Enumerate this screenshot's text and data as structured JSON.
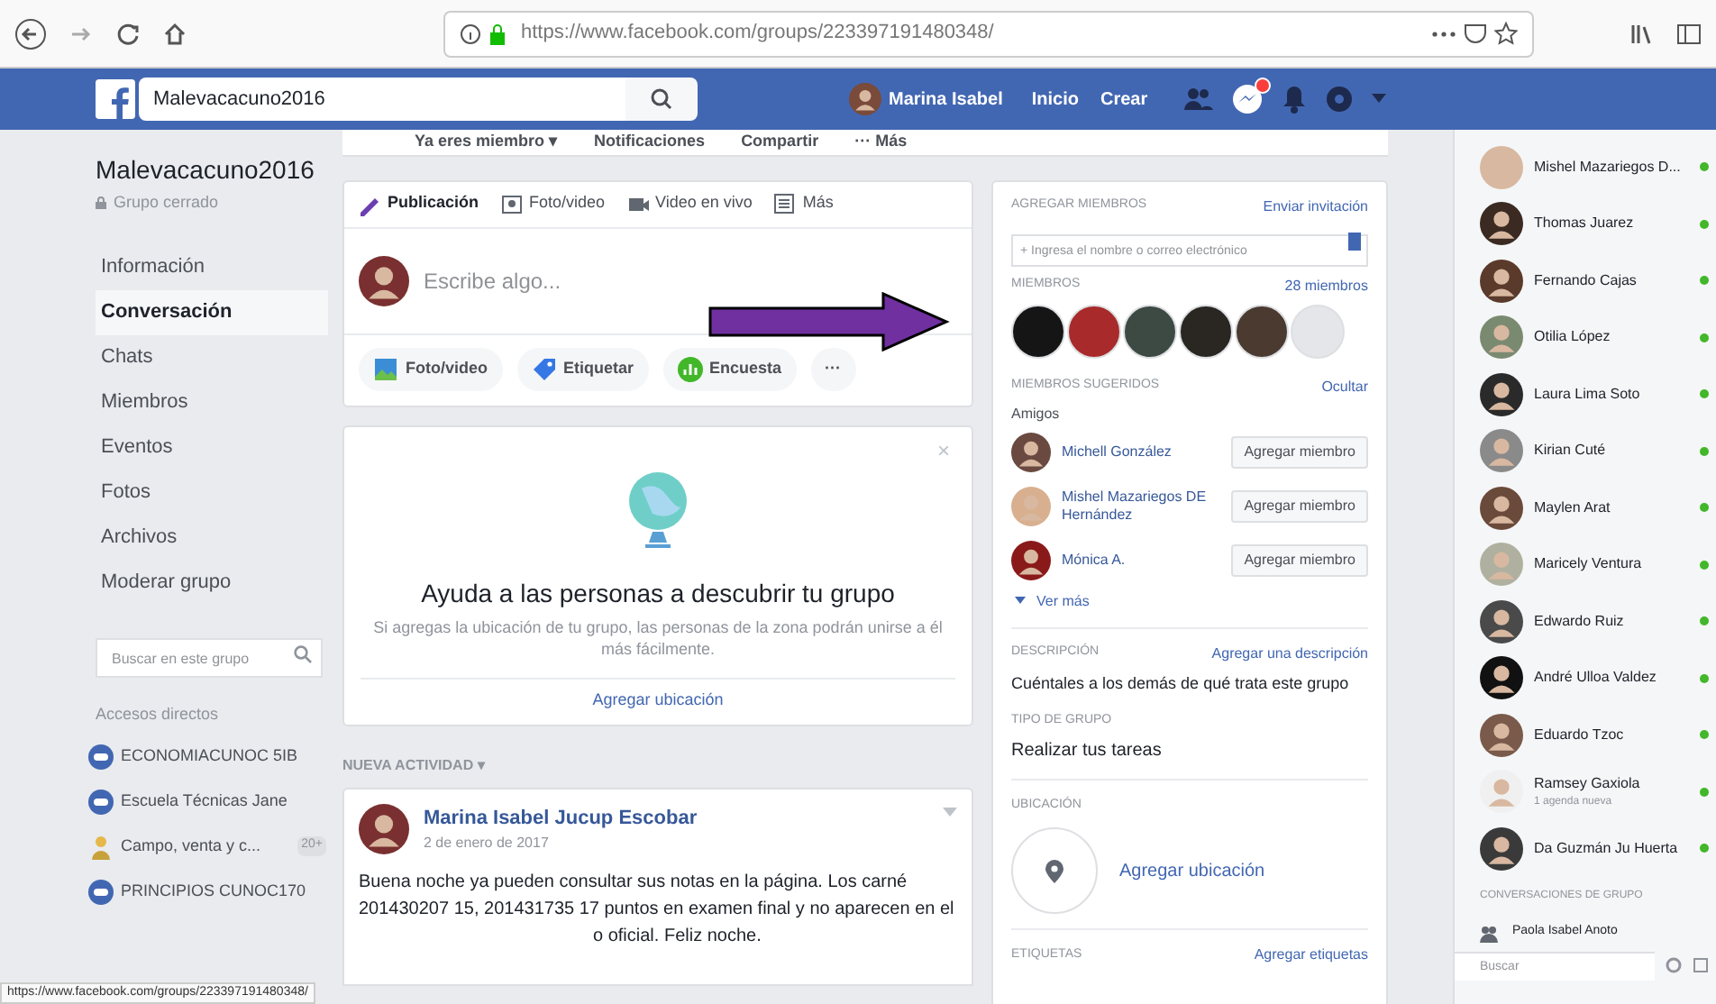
{
  "browser": {
    "url": "https://www.facebook.com/groups/223397191480348/"
  },
  "topbar": {
    "search_value": "Malevacacuno2016",
    "user": "Marina Isabel",
    "links": [
      "Inicio",
      "Crear"
    ],
    "notification_badge": true
  },
  "cover_actions": [
    "Ya eres miembro ▾",
    "Notificaciones",
    "Compartir",
    "··· Más"
  ],
  "group": {
    "name": "Malevacacuno2016",
    "privacy": "Grupo cerrado"
  },
  "sidebar": {
    "items": [
      {
        "label": "Información",
        "selected": false
      },
      {
        "label": "Conversación",
        "selected": true
      },
      {
        "label": "Chats",
        "selected": false
      },
      {
        "label": "Miembros",
        "selected": false
      },
      {
        "label": "Eventos",
        "selected": false
      },
      {
        "label": "Fotos",
        "selected": false
      },
      {
        "label": "Archivos",
        "selected": false
      },
      {
        "label": "Moderar grupo",
        "selected": false
      }
    ],
    "search_placeholder": "Buscar en este grupo",
    "shortcuts_title": "Accesos directos",
    "shortcuts": [
      {
        "label": "ECONOMIACUNOC 5IB",
        "kind": "group"
      },
      {
        "label": "Escuela Técnicas Jane",
        "kind": "group"
      },
      {
        "label": "Campo, venta y c...",
        "kind": "page",
        "count": "20+"
      },
      {
        "label": "PRINCIPIOS CUNOC170",
        "kind": "group"
      }
    ]
  },
  "composer": {
    "tabs": [
      {
        "label": "Publicación",
        "selected": true
      },
      {
        "label": "Foto/video",
        "selected": false
      },
      {
        "label": "Video en vivo",
        "selected": false
      },
      {
        "label": "Más",
        "selected": false
      }
    ],
    "placeholder": "Escribe algo...",
    "actions": [
      "Foto/video",
      "Etiquetar",
      "Encuesta",
      "···"
    ]
  },
  "discover_card": {
    "close": "×",
    "title": "Ayuda a las personas a descubrir tu grupo",
    "text": "Si agregas la ubicación de tu grupo, las personas de la zona podrán unirse a él más fácilmente.",
    "link": "Agregar ubicación"
  },
  "feed_sort": "NUEVA ACTIVIDAD ▾",
  "post": {
    "author": "Marina Isabel Jucup Escobar",
    "date": "2 de enero de 2017",
    "text": "Buena noche ya pueden consultar sus notas en la página. Los carné 201430207 15, 201431735 17 puntos en examen final y no aparecen en el",
    "text_tail": "o oficial. Feliz noche."
  },
  "members_panel": {
    "add_title": "AGREGAR MIEMBROS",
    "invite_link": "Enviar invitación",
    "add_placeholder": "+ Ingresa el nombre o correo electrónico",
    "members_title": "MIEMBROS",
    "members_count": "28 miembros",
    "member_avatars": [
      {
        "color": "#151515"
      },
      {
        "color": "#a82a2a"
      },
      {
        "color": "#3d4a44"
      },
      {
        "color": "#2a2622"
      },
      {
        "color": "#4a3a30"
      },
      {
        "color": "#e4e6e9"
      }
    ],
    "suggested_title": "MIEMBROS SUGERIDOS",
    "hide_link": "Ocultar",
    "friends_label": "Amigos",
    "suggested": [
      {
        "name": "Michell González",
        "button": "Agregar miembro"
      },
      {
        "name": "Mishel Mazariegos DE Hernández",
        "button": "Agregar miembro"
      },
      {
        "name": "Mónica A.",
        "button": "Agregar miembro"
      }
    ],
    "see_more": "Ver más",
    "description_title": "DESCRIPCIÓN",
    "description_link": "Agregar una descripción",
    "description_text": "Cuéntales a los demás de qué trata este grupo",
    "type_title": "TIPO DE GRUPO",
    "type_text": "Realizar tus tareas",
    "location_title": "UBICACIÓN",
    "location_link": "Agregar ubicación",
    "tags_title": "ETIQUETAS",
    "tags_link": "Agregar etiquetas"
  },
  "chat": {
    "contacts": [
      {
        "name": "Mishel Mazariegos D...",
        "online": true
      },
      {
        "name": "Thomas Juarez",
        "online": true
      },
      {
        "name": "Fernando Cajas",
        "online": true
      },
      {
        "name": "Otilia López",
        "online": true
      },
      {
        "name": "Laura Lima Soto",
        "online": true
      },
      {
        "name": "Kirian Cuté",
        "online": true
      },
      {
        "name": "Maylen Arat",
        "online": true
      },
      {
        "name": "Maricely Ventura",
        "online": true
      },
      {
        "name": "Edwardo Ruiz",
        "online": true
      },
      {
        "name": "André Ulloa Valdez",
        "online": true
      },
      {
        "name": "Eduardo Tzoc",
        "online": true
      },
      {
        "name": "Ramsey Gaxiola",
        "online": true,
        "sub": "1 agenda nueva"
      },
      {
        "name": "Da Guzmán Ju Huerta",
        "online": true
      }
    ],
    "group_title": "CONVERSACIONES DE GRUPO",
    "group_item": "Paola Isabel Anoto",
    "search_placeholder": "Buscar"
  },
  "status_bar": "https://www.facebook.com/groups/223397191480348/"
}
